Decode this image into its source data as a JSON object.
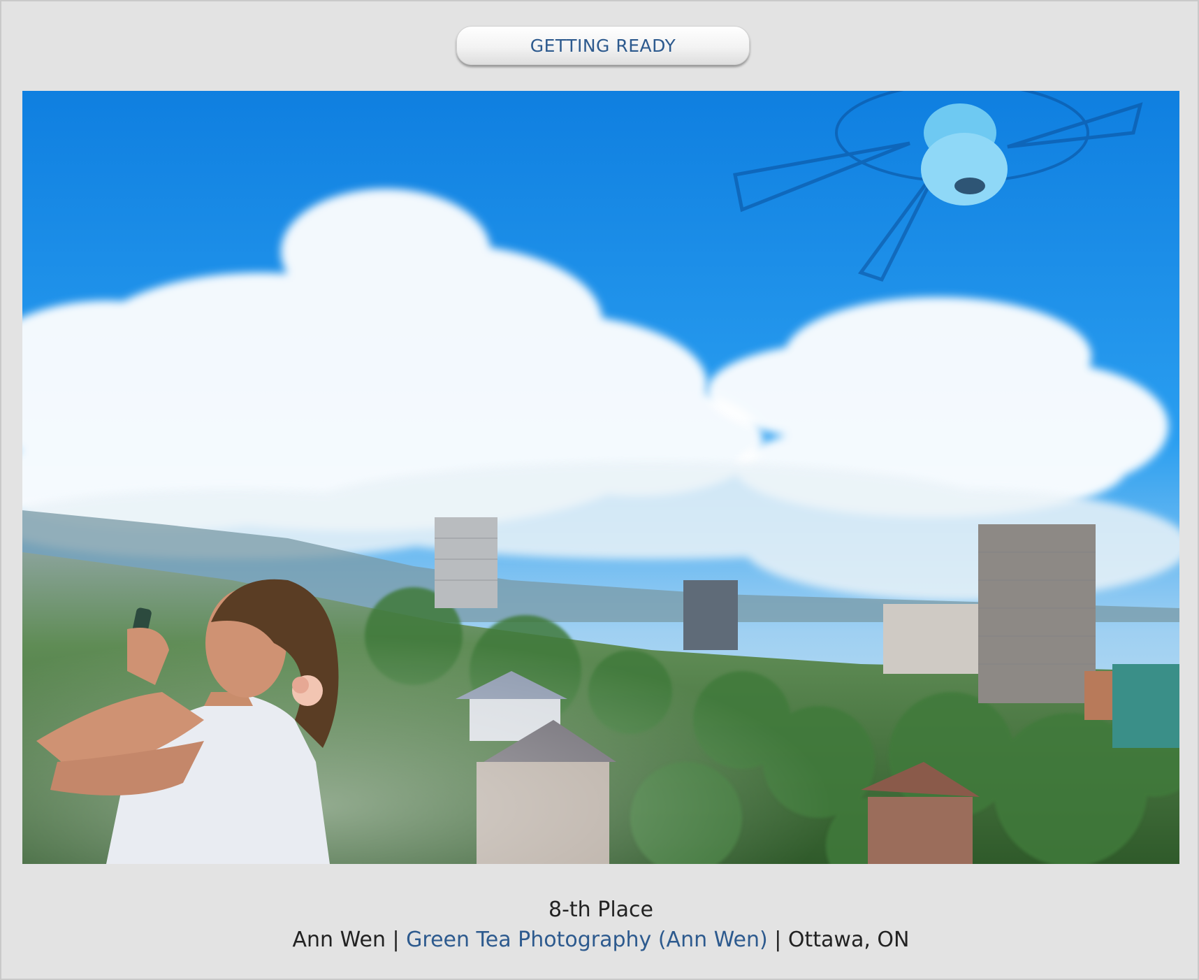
{
  "category": {
    "label": "GETTING READY"
  },
  "photo": {
    "alt": ""
  },
  "award": {
    "place": "8-th Place"
  },
  "credits": {
    "photographer": "Ann Wen",
    "separator_1": " | ",
    "studio_link": "Green Tea Photography (Ann Wen)",
    "separator_2": " | ",
    "location": "Ottawa, ON"
  },
  "colors": {
    "background": "#e3e3e3",
    "link": "#2d5a8e",
    "sky": "#1e90e0"
  }
}
